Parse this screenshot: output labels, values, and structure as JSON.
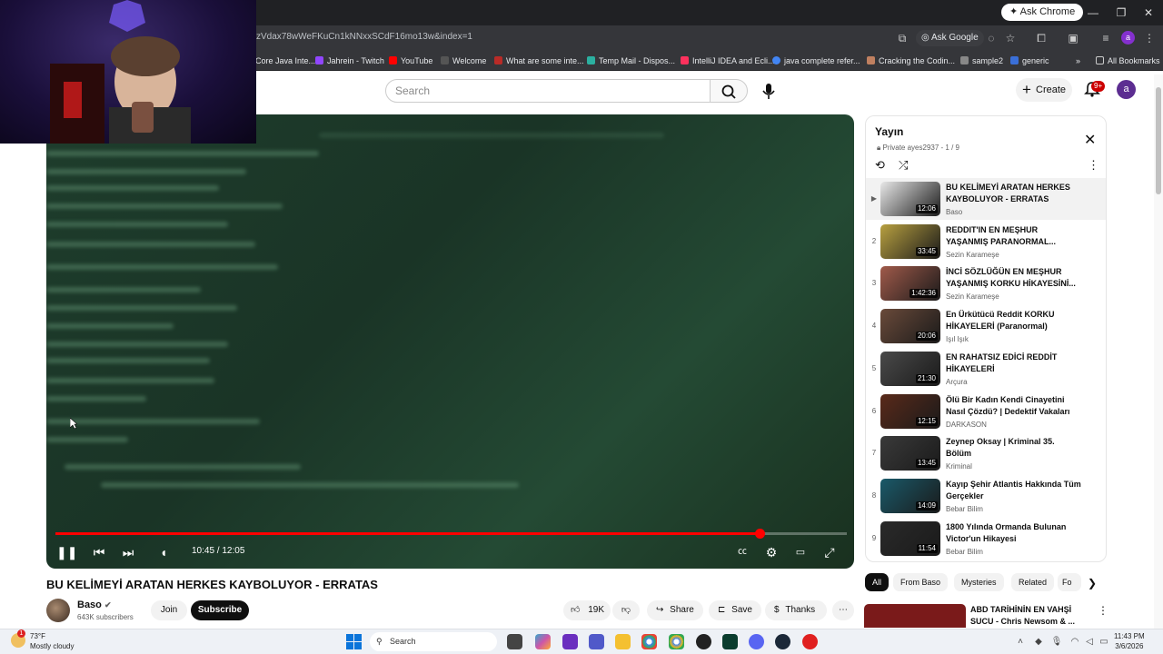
{
  "browser": {
    "ask_chrome": "Ask Chrome",
    "url": "zVdax78wWeFKuCn1kNNxxSCdF16mo13w&index=1",
    "ask_google": "Ask Google",
    "profile_initial": "a",
    "bookmarks": [
      "Core Java Inte...",
      "Jahrein - Twitch",
      "YouTube",
      "Welcome",
      "What are some inte...",
      "Temp Mail - Dispos...",
      "IntelliJ IDEA and Ecli...",
      "java complete refer...",
      "Cracking the Codin...",
      "sample2",
      "generic"
    ],
    "all_bookmarks": "All Bookmarks"
  },
  "header": {
    "search_placeholder": "Search",
    "create_label": "Create",
    "notif_count": "9+",
    "avatar_initial": "a"
  },
  "player": {
    "time": "10:45 / 12:05",
    "progress": 0.89
  },
  "video": {
    "title": "BU KELİMEYİ ARATAN HERKES KAYBOLUYOR - ERRATAS",
    "channel": "Baso",
    "subscribers": "643K subscribers",
    "join": "Join",
    "subscribe": "Subscribe",
    "likes": "19K",
    "share": "Share",
    "save": "Save",
    "thanks": "Thanks"
  },
  "playlist": {
    "title": "Yayın",
    "meta": "Private  ayes2937 - 1 / 9",
    "items": [
      {
        "index": "▶",
        "title": "BU KELİMEYİ ARATAN HERKES KAYBOLUYOR - ERRATAS",
        "channel": "Baso",
        "duration": "12:06",
        "color": "#e8e8e8"
      },
      {
        "index": "2",
        "title": "REDDIT'IN EN MEŞHUR YAŞANMIŞ PARANORMAL...",
        "channel": "Sezin Karameşe",
        "duration": "33:45",
        "color": "#b8a040"
      },
      {
        "index": "3",
        "title": "İNCİ SÖZLÜĞÜN EN MEŞHUR YAŞANMIŞ KORKU HİKAYESİNİ...",
        "channel": "Sezin Karameşe",
        "duration": "1:42:36",
        "color": "#a05a4a"
      },
      {
        "index": "4",
        "title": "En Ürkütücü Reddit KORKU HİKAYELERİ (Paranormal)",
        "channel": "Işıl Işık",
        "duration": "20:06",
        "color": "#6a4a3a"
      },
      {
        "index": "5",
        "title": "EN RAHATSIZ EDİCİ REDDİT HİKAYELERİ",
        "channel": "Arçura",
        "duration": "21:30",
        "color": "#4a4a4a"
      },
      {
        "index": "6",
        "title": "Ölü Bir Kadın Kendi Cinayetini Nasıl Çözdü? | Dedektif Vakaları",
        "channel": "DARKASON",
        "duration": "12:15",
        "color": "#5a2a1a"
      },
      {
        "index": "7",
        "title": "Zeynep Oksay | Kriminal 35. Bölüm",
        "channel": "Kriminal",
        "duration": "13:45",
        "color": "#3a3a3a"
      },
      {
        "index": "8",
        "title": "Kayıp Şehir Atlantis Hakkında Tüm Gerçekler",
        "channel": "Bebar Bilim",
        "duration": "14:09",
        "color": "#1a5a6a"
      },
      {
        "index": "9",
        "title": "1800 Yılında Ormanda Bulunan Victor'un Hikayesi",
        "channel": "Bebar Bilim",
        "duration": "11:54",
        "color": "#2a2a2a"
      }
    ]
  },
  "chips": [
    "All",
    "From Baso",
    "Mysteries",
    "Related",
    "Fo"
  ],
  "recommendation": {
    "title": "ABD TARİHİNİN EN VAHŞİ SUCU - Chris Newsom & ..."
  },
  "taskbar": {
    "weather_temp": "73°F",
    "weather_desc": "Mostly cloudy",
    "weather_badge": "1",
    "search": "Search",
    "time": "11:43 PM",
    "date": "3/6/2026"
  }
}
